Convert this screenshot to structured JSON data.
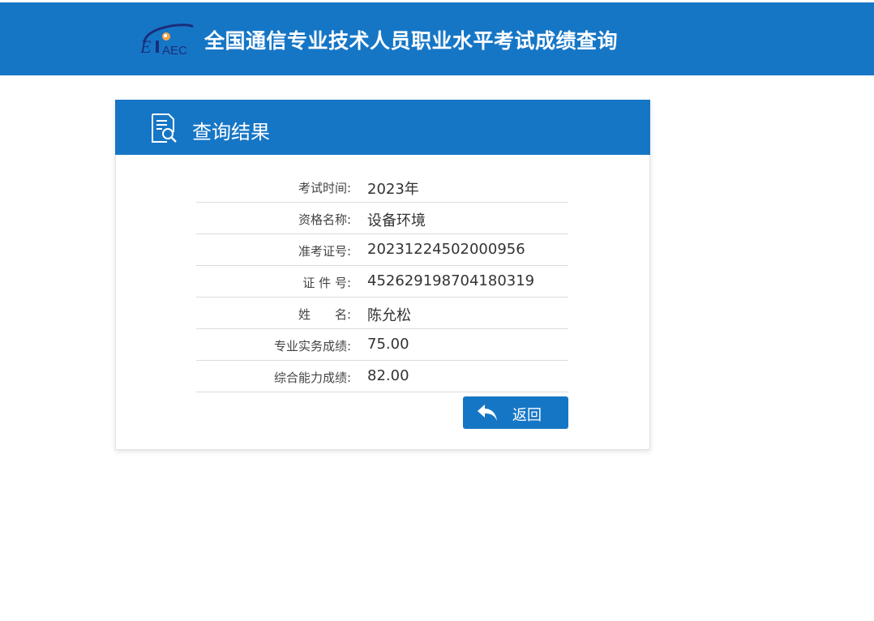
{
  "header": {
    "logo_text": "EIAEC",
    "title": "全国通信专业技术人员职业水平考试成绩查询"
  },
  "panel": {
    "title": "查询结果",
    "rows": [
      {
        "label": "考试时间:",
        "value": "2023年"
      },
      {
        "label": "资格名称:",
        "value": "设备环境"
      },
      {
        "label": "准考证号:",
        "value": "20231224502000956"
      },
      {
        "label": "证 件 号:",
        "value": "452629198704180319"
      },
      {
        "label": "姓　　名:",
        "value": "陈允松"
      },
      {
        "label": "专业实务成绩:",
        "value": "75.00"
      },
      {
        "label": "综合能力成绩:",
        "value": "82.00"
      }
    ],
    "back_label": "返回"
  },
  "colors": {
    "primary": "#1676c6",
    "divider": "#dcdcdc"
  },
  "icons": {
    "logo": "eiaec-logo",
    "result": "document-search-icon",
    "back": "reply-arrow-icon"
  }
}
